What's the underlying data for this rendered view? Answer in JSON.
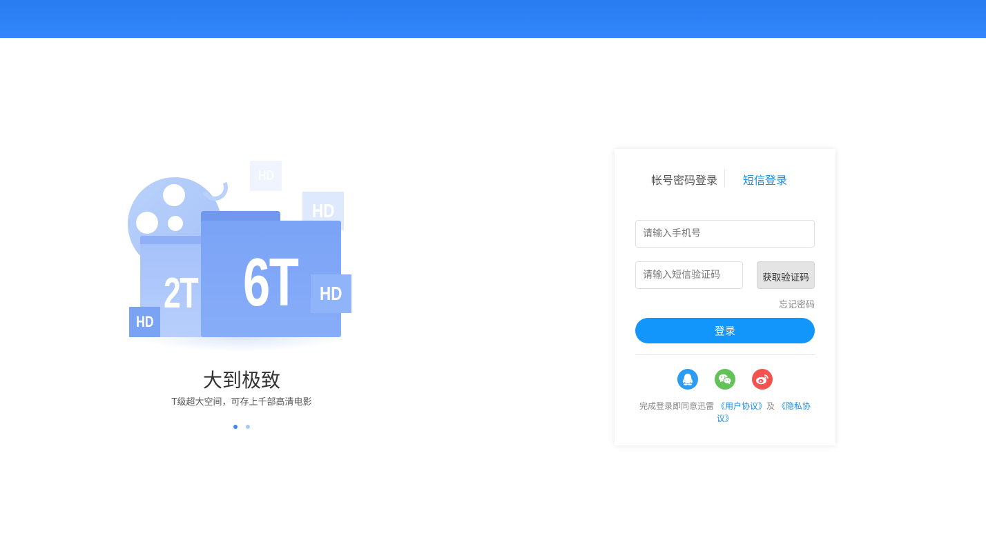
{
  "colors": {
    "header": "#2f84f7",
    "accent": "#1296fb",
    "link": "#1b8ee8",
    "qq": "#2c9bf2",
    "wechat": "#64c25a",
    "weibo": "#f2534e"
  },
  "promo": {
    "illustration": {
      "hd_badge": "HD",
      "folder_small": "2T",
      "folder_large": "6T"
    },
    "title": "大到极致",
    "subtitle": "T级超大空间，可存上千部高清电影",
    "carousel_dots": 2,
    "active_dot": 1
  },
  "login": {
    "tabs": [
      {
        "label": "帐号密码登录",
        "active": false
      },
      {
        "label": "短信登录",
        "active": true
      }
    ],
    "phone_placeholder": "请输入手机号",
    "code_placeholder": "请输入短信验证码",
    "get_code_label": "获取验证码",
    "forgot_label": "忘记密码",
    "submit_label": "登录",
    "social": [
      {
        "name": "qq",
        "icon": "qq-penguin-icon"
      },
      {
        "name": "wechat",
        "icon": "wechat-icon"
      },
      {
        "name": "weibo",
        "icon": "weibo-icon"
      }
    ],
    "agreement": {
      "prefix": "完成登录即同意迅雷",
      "user_agreement": "《用户协议》",
      "and": "及",
      "privacy_policy": "《隐私协议》"
    }
  }
}
